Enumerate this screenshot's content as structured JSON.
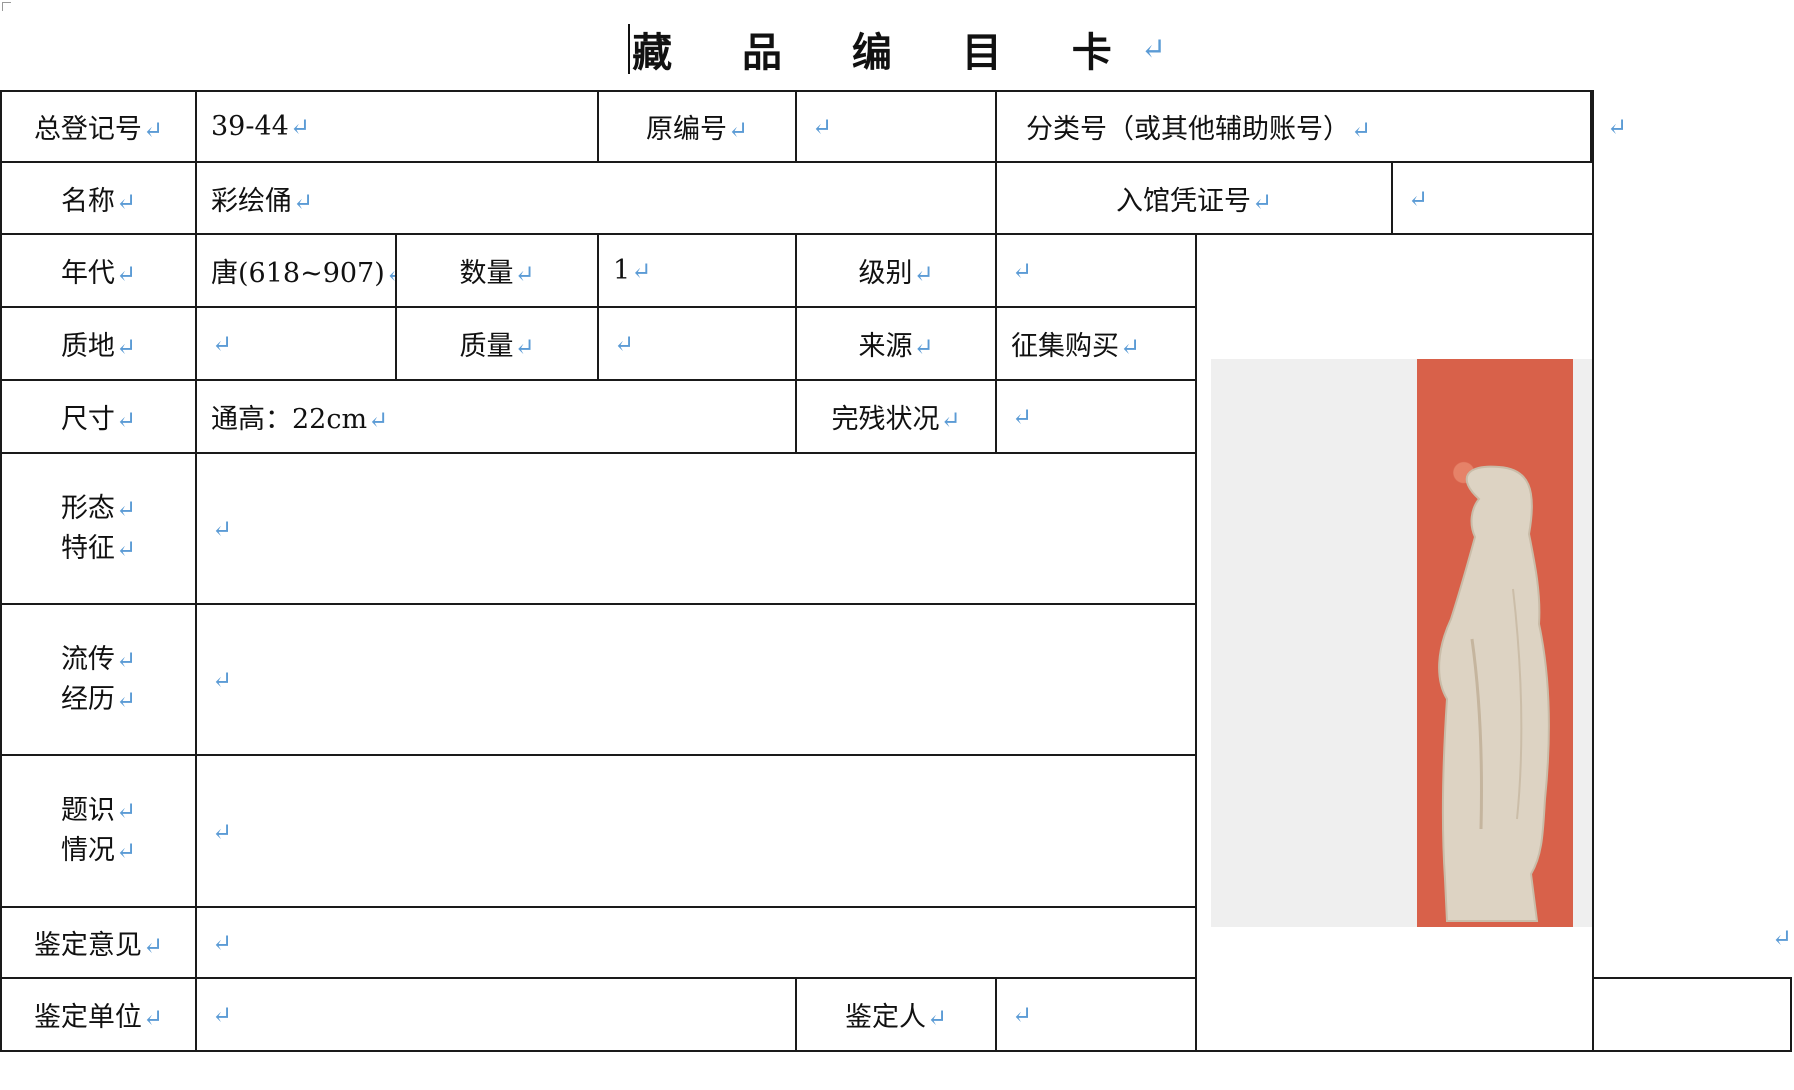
{
  "title": "藏 品 编 目 卡",
  "pmark": "↵",
  "rows": {
    "registration_no": {
      "label": "总登记号",
      "value": "39-44"
    },
    "original_no": {
      "label": "原编号",
      "value": ""
    },
    "category_no": {
      "label": "分类号（或其他辅助账号）",
      "value": ""
    },
    "name": {
      "label": "名称",
      "value": "彩绘俑"
    },
    "entry_voucher": {
      "label": "入馆凭证号",
      "value": ""
    },
    "era": {
      "label": "年代",
      "value": "唐(618~907)"
    },
    "quantity": {
      "label": "数量",
      "value": "1"
    },
    "grade": {
      "label": "级别",
      "value": ""
    },
    "material": {
      "label": "质地",
      "value": ""
    },
    "weight": {
      "label": "质量",
      "value": ""
    },
    "source": {
      "label": "来源",
      "value": "征集购买"
    },
    "dimensions": {
      "label": "尺寸",
      "value": "通高：22cm"
    },
    "condition": {
      "label": "完残状况",
      "value": ""
    },
    "form": {
      "label_1": "形态",
      "label_2": "特征",
      "value": ""
    },
    "provenance": {
      "label_1": "流传",
      "label_2": "经历",
      "value": ""
    },
    "inscription": {
      "label_1": "题识",
      "label_2": "情况",
      "value": ""
    },
    "appraisal_opinion": {
      "label": "鉴定意见",
      "value": ""
    },
    "appraisal_unit": {
      "label": "鉴定单位",
      "value": ""
    },
    "appraiser": {
      "label": "鉴定人",
      "value": ""
    }
  },
  "colors": {
    "pmark": "#5b9bd5",
    "photo_bg": "#efefef",
    "cloth": "#d8614a",
    "figurine": "#ddd3c3"
  },
  "icons": {
    "paragraph_mark": "paragraph-return-icon"
  }
}
